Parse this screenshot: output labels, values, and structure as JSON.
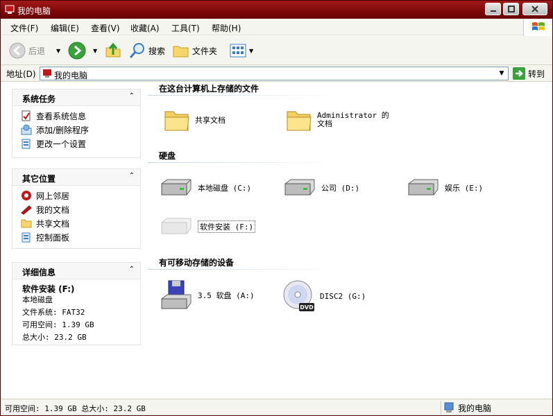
{
  "window": {
    "title": "我的电脑"
  },
  "menu": [
    {
      "label": "文件(F)"
    },
    {
      "label": "编辑(E)"
    },
    {
      "label": "查看(V)"
    },
    {
      "label": "收藏(A)"
    },
    {
      "label": "工具(T)"
    },
    {
      "label": "帮助(H)"
    }
  ],
  "toolbar": {
    "back": "后退",
    "search": "搜索",
    "folders": "文件夹"
  },
  "address": {
    "label": "地址(D)",
    "value": "我的电脑",
    "go": "转到"
  },
  "left": {
    "tasks": {
      "title": "系统任务",
      "items": [
        "查看系统信息",
        "添加/删除程序",
        "更改一个设置"
      ]
    },
    "places": {
      "title": "其它位置",
      "items": [
        "网上邻居",
        "我的文档",
        "共享文档",
        "控制面板"
      ]
    },
    "details": {
      "title": "详细信息",
      "name": "软件安装 (F:)",
      "type": "本地磁盘",
      "fs": "文件系统: FAT32",
      "free": "可用空间: 1.39 GB",
      "total": "总大小: 23.2 GB"
    }
  },
  "main": {
    "section_files": "在这台计算机上存储的文件",
    "files": [
      "共享文档",
      "Administrator 的文档"
    ],
    "section_hdd": "硬盘",
    "drives": [
      "本地磁盘 (C:)",
      "公司 (D:)",
      "娱乐 (E:)",
      "软件安装 (F:)"
    ],
    "section_removable": "有可移动存储的设备",
    "removable": [
      "3.5 软盘 (A:)",
      "DISC2 (G:)"
    ]
  },
  "status": {
    "left": "可用空间: 1.39 GB 总大小: 23.2 GB",
    "right": "我的电脑"
  },
  "colors": {
    "titlebar": "#7d0808",
    "pane_bg": "#ffffff",
    "bar_bg": "#f5f5f0"
  }
}
